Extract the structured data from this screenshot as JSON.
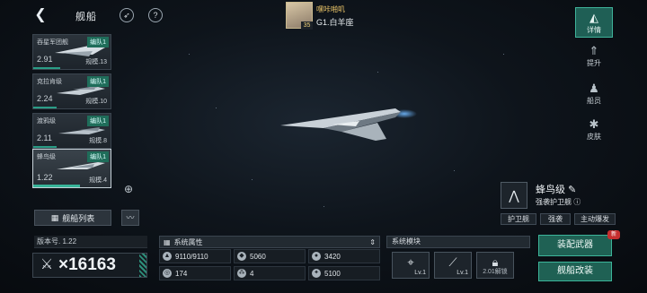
{
  "header": {
    "title": "舰船",
    "back_icon": "back-arrow-icon",
    "rocket_icon": "rocket-icon",
    "help_icon": "question-icon"
  },
  "player": {
    "name": "嘿咔啪叽",
    "rank": "G1.白羊座",
    "level": "35"
  },
  "ships": [
    {
      "name": "吞星军团舰",
      "team": "编队1",
      "rating": "2.91",
      "scale": "规模.13",
      "progress": 0.35,
      "selected": false
    },
    {
      "name": "克拉肯级",
      "team": "编队1",
      "rating": "2.24",
      "scale": "规模.10",
      "progress": 0.3,
      "selected": false
    },
    {
      "name": "渡鸦级",
      "team": "编队1",
      "rating": "2.11",
      "scale": "规模.8",
      "progress": 0.3,
      "selected": false
    },
    {
      "name": "蜂鸟级",
      "team": "编队1",
      "rating": "1.22",
      "scale": "规模.4",
      "progress": 0.6,
      "selected": true
    }
  ],
  "fleet_list": {
    "label": "舰船列表"
  },
  "version": "版本号. 1.22",
  "power": "16163",
  "attributes": {
    "title": "系统属性",
    "cells": [
      {
        "value": "9110/9110",
        "icon": "hull-icon"
      },
      {
        "value": "5060",
        "icon": "armor-icon"
      },
      {
        "value": "3420",
        "icon": "shield-icon"
      },
      {
        "value": "174",
        "icon": "speed-icon"
      },
      {
        "value": "4",
        "icon": "cluster-icon"
      },
      {
        "value": "5100",
        "icon": "energy-icon"
      }
    ]
  },
  "modules": {
    "title": "系统模块",
    "slots": [
      {
        "level": "Lv.1",
        "icon": "target-icon"
      },
      {
        "level": "Lv.1",
        "icon": "cannon-icon"
      },
      {
        "unlock": "2.01解锁",
        "icon": "lock-icon"
      }
    ]
  },
  "side_nav": [
    {
      "label": "详情",
      "icon": "details-icon",
      "active": true
    },
    {
      "label": "提升",
      "icon": "upgrade-icon",
      "active": false
    },
    {
      "label": "船员",
      "icon": "crew-icon",
      "active": false
    },
    {
      "label": "皮肤",
      "icon": "skin-icon",
      "active": false
    }
  ],
  "ship_info": {
    "name": "蜂鸟级",
    "class": "强袭护卫舰",
    "tags": [
      "护卫舰",
      "强袭",
      "主动爆发"
    ]
  },
  "actions": {
    "equip": "装配武器",
    "equip_badge": "新",
    "refit": "舰船改装"
  },
  "colors": {
    "accent": "#1f6154",
    "accent_border": "#3cb59a",
    "badge_red": "#c62f2f"
  }
}
